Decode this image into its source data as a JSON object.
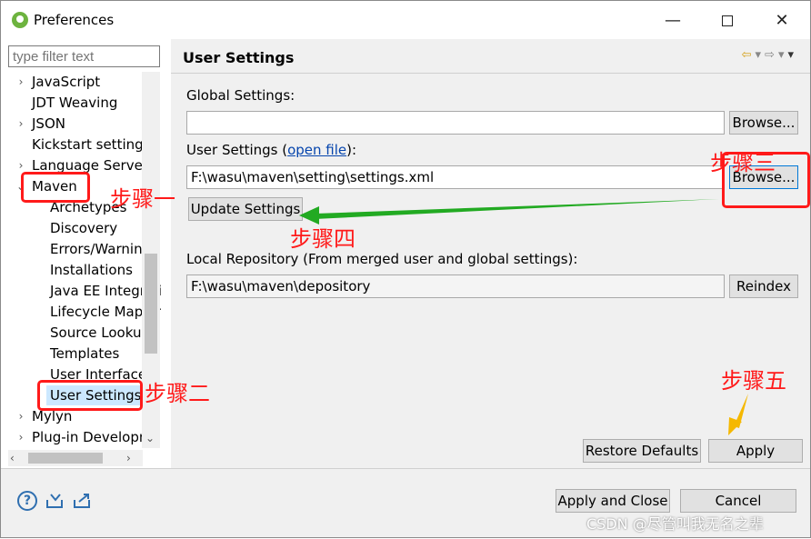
{
  "window": {
    "title": "Preferences",
    "minimize": "—",
    "close": "✕"
  },
  "filter": {
    "placeholder": "type filter text"
  },
  "tree": {
    "items": [
      {
        "label": "JavaScript",
        "chev": "›"
      },
      {
        "label": "JDT Weaving",
        "chev": ""
      },
      {
        "label": "JSON",
        "chev": "›"
      },
      {
        "label": "Kickstart settings",
        "chev": ""
      },
      {
        "label": "Language Servers",
        "chev": "›"
      },
      {
        "label": "Maven",
        "chev": "⌄"
      },
      {
        "label": "Archetypes",
        "chev": ""
      },
      {
        "label": "Discovery",
        "chev": ""
      },
      {
        "label": "Errors/Warnings",
        "chev": ""
      },
      {
        "label": "Installations",
        "chev": ""
      },
      {
        "label": "Java EE Integration",
        "chev": ""
      },
      {
        "label": "Lifecycle Mappings",
        "chev": ""
      },
      {
        "label": "Source Lookup",
        "chev": ""
      },
      {
        "label": "Templates",
        "chev": ""
      },
      {
        "label": "User Interface",
        "chev": ""
      },
      {
        "label": "User Settings",
        "chev": ""
      },
      {
        "label": "Mylyn",
        "chev": "›"
      },
      {
        "label": "Plug-in Development",
        "chev": "›"
      }
    ],
    "scroll_down": "⌄",
    "scroll_left": "‹",
    "scroll_right": "›"
  },
  "page": {
    "title": "User Settings",
    "global_label": "Global Settings:",
    "global_value": "",
    "global_browse": "Browse...",
    "user_label_prefix": "User Settings (",
    "user_label_link": "open file",
    "user_label_suffix": "):",
    "user_value": "F:\\wasu\\maven\\setting\\settings.xml",
    "user_browse": "Browse...",
    "update_settings": "Update Settings",
    "local_label": "Local Repository (From merged user and global settings):",
    "local_value": "F:\\wasu\\maven\\depository",
    "reindex": "Reindex",
    "restore_defaults": "Restore Defaults",
    "apply": "Apply"
  },
  "footer": {
    "help": "?",
    "apply_and_close": "Apply and Close",
    "cancel": "Cancel"
  },
  "annotations": {
    "step1": "步骤一",
    "step2": "步骤二",
    "step3": "步骤三",
    "step4": "步骤四",
    "step5": "步骤五",
    "annotation_red": "#ff1a1a",
    "arrow_green": "#22aa22",
    "arrow_yellow": "#f5b800"
  },
  "watermark": "CSDN @尽管叫我无名之辈"
}
